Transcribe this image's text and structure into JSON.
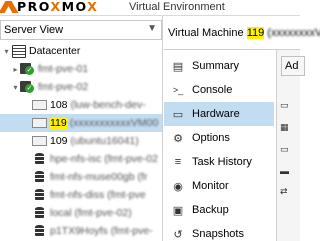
{
  "topbar": {
    "logo_prefix": "PRO",
    "logo_x": "X",
    "logo_suffix": "MO",
    "logo_x2": "X",
    "title": "Virtual Environment"
  },
  "left": {
    "view_selector": "Server View",
    "tree": [
      {
        "kind": "datacenter",
        "label": "Datacenter",
        "expanded": true
      },
      {
        "kind": "node",
        "label": "fmt-pve-01",
        "expanded": false
      },
      {
        "kind": "node",
        "label": "fmt-pve-02",
        "expanded": true
      },
      {
        "kind": "vm",
        "id": "108",
        "name": "(luw-bench-dev-"
      },
      {
        "kind": "vm",
        "id": "119",
        "name": "(xxxxxxxxxxxVM00",
        "selected": true,
        "highlight_id": true
      },
      {
        "kind": "vm",
        "id": "109",
        "name": "(ubuntu16041)"
      },
      {
        "kind": "storage",
        "label": "hpe-nfs-isc (fmt-pve-02"
      },
      {
        "kind": "storage",
        "label": "fmt-nfs-muse00gb (fr"
      },
      {
        "kind": "storage",
        "label": "fmt-nfs-diss (fmt-pve"
      },
      {
        "kind": "storage",
        "label": "local (fmt-pve-02)"
      },
      {
        "kind": "storage",
        "label": "p1TX9Hoyfs (fmt-pve-"
      }
    ]
  },
  "right": {
    "title_prefix": "Virtual Machine",
    "vm_id": "119",
    "vm_name": "(xxxxxxxxVM",
    "menu": [
      {
        "icon": "book-icon",
        "glyph": "▤",
        "label": "Summary"
      },
      {
        "icon": "console-icon",
        "glyph": ">_",
        "label": "Console"
      },
      {
        "icon": "monitor-icon",
        "glyph": "▭",
        "label": "Hardware",
        "active": true
      },
      {
        "icon": "gear-icon",
        "glyph": "⚙",
        "label": "Options"
      },
      {
        "icon": "list-icon",
        "glyph": "≡",
        "label": "Task History"
      },
      {
        "icon": "eye-icon",
        "glyph": "◉",
        "label": "Monitor"
      },
      {
        "icon": "floppy-icon",
        "glyph": "▣",
        "label": "Backup"
      },
      {
        "icon": "history-icon",
        "glyph": "↺",
        "label": "Snapshots"
      }
    ],
    "add_button": "Ad"
  },
  "colors": {
    "brand_orange": "#e57000",
    "selection": "#c2ddf2",
    "highlight": "#fff100",
    "status_green": "#2ca02c"
  }
}
